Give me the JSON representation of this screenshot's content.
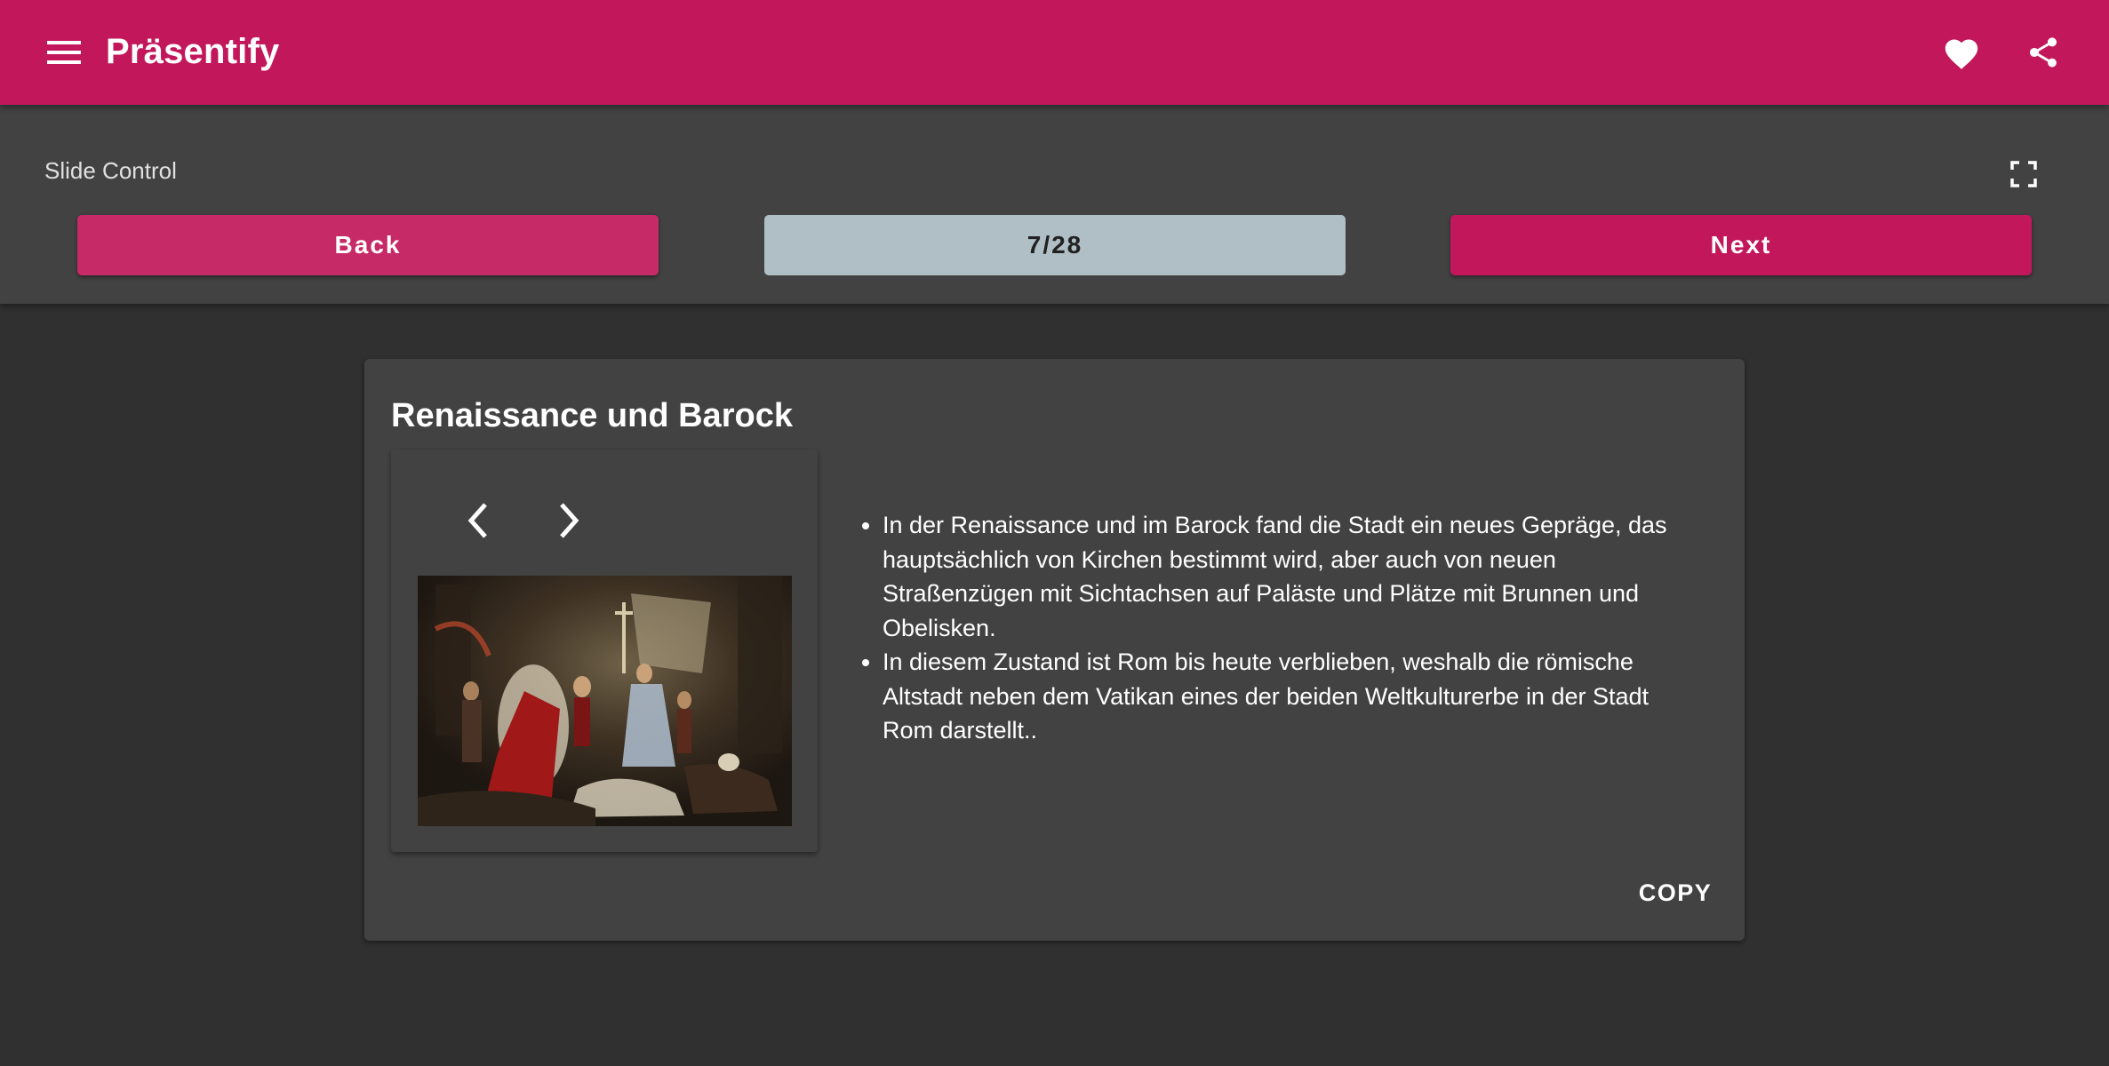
{
  "app": {
    "title": "Präsentify",
    "brand_color": "#c2185b",
    "icons": {
      "menu": "menu-icon",
      "favorite": "heart-icon",
      "share": "share-icon"
    }
  },
  "slide_control": {
    "label": "Slide Control",
    "back_label": "Back",
    "counter": "7/28",
    "next_label": "Next",
    "fullscreen_icon": "fullscreen-icon"
  },
  "slide": {
    "title": "Renaissance und Barock",
    "image_icons": {
      "prev": "chevron-left-icon",
      "next": "chevron-right-icon"
    },
    "bullets": [
      "In der Renaissance und im Barock fand die Stadt ein neues Gepräge, das hauptsächlich von Kirchen bestimmt wird, aber auch von neuen Straßenzügen mit Sichtachsen auf Paläste und Plätze mit Brunnen und Obelisken.",
      "In diesem Zustand ist Rom bis heute verblieben, weshalb die römische Altstadt neben dem Vatikan eines der beiden Weltkulturerbe in der Stadt Rom darstellt.."
    ],
    "copy_label": "COPY"
  }
}
